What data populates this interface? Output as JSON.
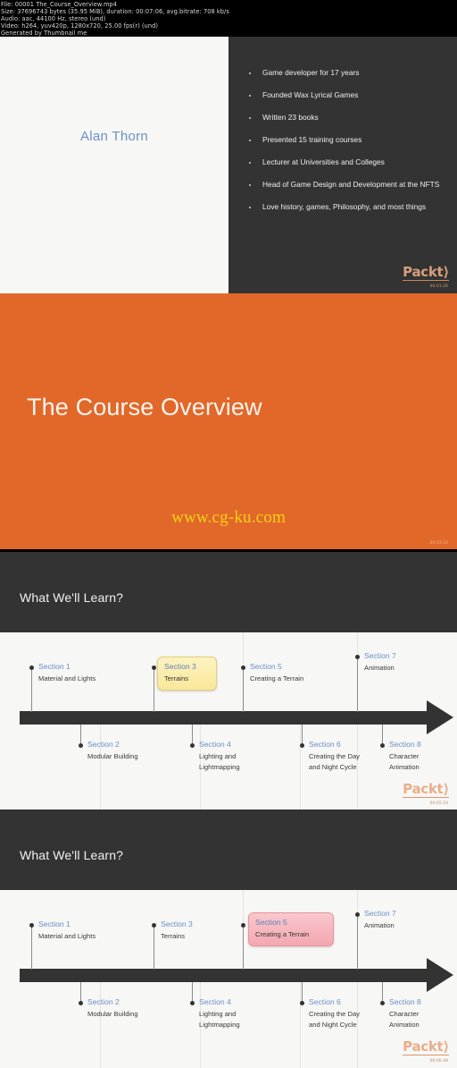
{
  "meta_header": {
    "lines": [
      "File: 00001 The_Course_Overview.mp4",
      "Size: 37696743 bytes (35.95 MiB), duration: 00:07:06, avg.bitrate: 708 kb/s",
      "Audio: aac, 44100 Hz, stereo (und)",
      "Video: h264, yuv420p, 1280x720, 25.00 fps(r) (und)",
      "Generated by Thumbnail me"
    ]
  },
  "slide_presenter": {
    "name": "Alan Thorn",
    "bullets": [
      "Game developer for 17 years",
      "Founded Wax Lyrical Games",
      "Written 23 books",
      "Presented 15 training courses",
      "Lecturer at Universities and Colleges",
      "Head of Game Design and Development at the NFTS",
      "Love history, games, Philosophy, and most things"
    ],
    "logo": "Packt",
    "timestamp": "00:01:26"
  },
  "slide_title": {
    "title": "The Course Overview",
    "watermark": "www.cg-ku.com",
    "timestamp": "00:03:32"
  },
  "slide_learn_1": {
    "heading": "What We'll Learn?",
    "logo": "Packt",
    "timestamp": "00:05:16",
    "nodes": [
      {
        "title": "Section 1",
        "desc": "Material and Lights",
        "highlight": "none"
      },
      {
        "title": "Section 2",
        "desc": "Modular Building",
        "highlight": "none"
      },
      {
        "title": "Section 3",
        "desc": "Terrains",
        "highlight": "yellow"
      },
      {
        "title": "Section 4",
        "desc": "Lighting and Lightmapping",
        "highlight": "none"
      },
      {
        "title": "Section 5",
        "desc": "Creating a Terrain",
        "highlight": "none"
      },
      {
        "title": "Section 6",
        "desc": "Creating the Day and Night Cycle",
        "highlight": "none"
      },
      {
        "title": "Section 7",
        "desc": "Animation",
        "highlight": "none"
      },
      {
        "title": "Section 8",
        "desc": "Character Animation",
        "highlight": "none"
      }
    ]
  },
  "slide_learn_2": {
    "heading": "What We'll Learn?",
    "logo": "Packt",
    "timestamp": "00:06:49",
    "nodes": [
      {
        "title": "Section 1",
        "desc": "Material and Lights",
        "highlight": "none"
      },
      {
        "title": "Section 2",
        "desc": "Modular Building",
        "highlight": "none"
      },
      {
        "title": "Section 3",
        "desc": "Terrains",
        "highlight": "none"
      },
      {
        "title": "Section 4",
        "desc": "Lighting and Lightmapping",
        "highlight": "none"
      },
      {
        "title": "Section 5",
        "desc": "Creating a Terrain",
        "highlight": "pink"
      },
      {
        "title": "Section 6",
        "desc": "Creating the Day and Night Cycle",
        "highlight": "none"
      },
      {
        "title": "Section 7",
        "desc": "Animation",
        "highlight": "none"
      },
      {
        "title": "Section 8",
        "desc": "Character Animation",
        "highlight": "none"
      }
    ]
  },
  "colors": {
    "orange": "#e2682a",
    "dark": "#333333",
    "slide_bg": "#f7f7f5",
    "accent_blue": "#6b8fc7",
    "watermark_yellow": "#f7d117",
    "highlight_yellow": "#f9e79a",
    "highlight_pink": "#f3a7b0",
    "packt_orange": "#e8a882"
  }
}
